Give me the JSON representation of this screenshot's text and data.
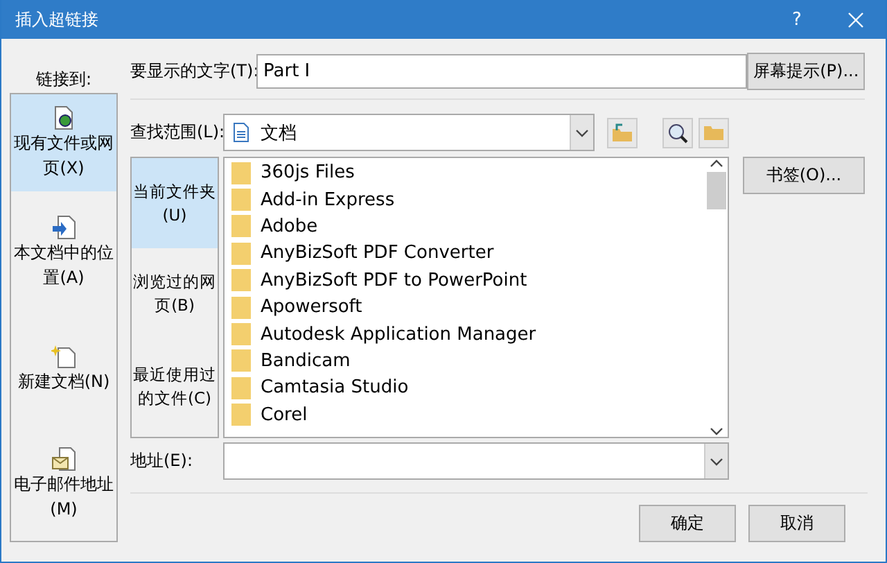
{
  "window": {
    "title": "插入超链接",
    "help": "?"
  },
  "link_to": {
    "label": "链接到:",
    "items": [
      {
        "kind": "file",
        "label": "现有文件或网页(X)",
        "selected": true
      },
      {
        "kind": "place",
        "label": "本文档中的位置(A)",
        "selected": false
      },
      {
        "kind": "new",
        "label": "新建文档(N)",
        "selected": false
      },
      {
        "kind": "email",
        "label": "电子邮件地址(M)",
        "selected": false
      }
    ]
  },
  "display_text": {
    "label": "要显示的文字(T):",
    "value": "Part Ⅰ"
  },
  "screentip_button": "屏幕提示(P)...",
  "look_in": {
    "label": "查找范围(L):",
    "value": "文档"
  },
  "nav": [
    {
      "label": "当前文件夹(U)",
      "selected": true
    },
    {
      "label": "浏览过的网页(B)",
      "selected": false
    },
    {
      "label": "最近使用过的文件(C)",
      "selected": false
    }
  ],
  "files": [
    "360js Files",
    "Add-in Express",
    "Adobe",
    "AnyBizSoft PDF Converter",
    "AnyBizSoft PDF to PowerPoint",
    "Apowersoft",
    "Autodesk Application Manager",
    "Bandicam",
    "Camtasia Studio",
    "Corel"
  ],
  "bookmark_button": "书签(O)...",
  "address": {
    "label": "地址(E):"
  },
  "buttons": [
    "确定",
    "取消"
  ]
}
